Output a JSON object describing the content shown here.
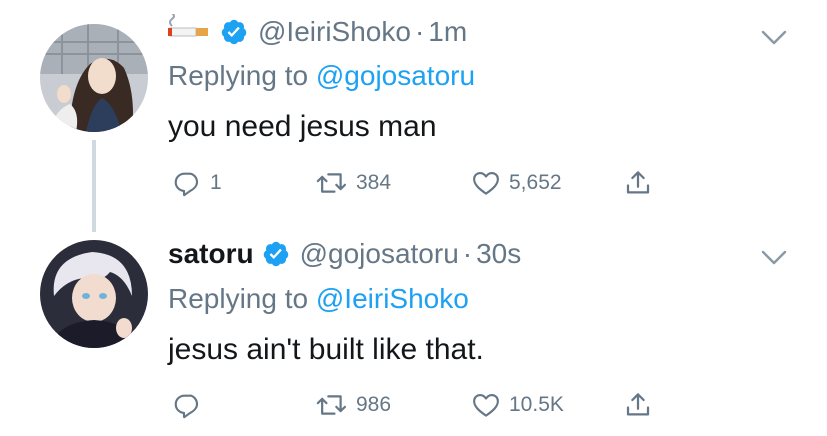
{
  "tweets": [
    {
      "display_name": "",
      "name_emoji": "cigarette-emoji",
      "handle": "@IeiriShoko",
      "separator": "·",
      "time": "1m",
      "replying_prefix": "Replying to",
      "replying_to": "@gojosatoru",
      "text": "you need jesus man",
      "reply_count": "1",
      "retweet_count": "384",
      "like_count": "5,652"
    },
    {
      "display_name": "satoru",
      "handle": "@gojosatoru",
      "separator": "·",
      "time": "30s",
      "replying_prefix": "Replying to",
      "replying_to": "@IeiriShoko",
      "text": "jesus ain't built like that.",
      "reply_count": "",
      "retweet_count": "986",
      "like_count": "10.5K"
    }
  ],
  "icons": {
    "verified": "verified-badge-icon",
    "reply": "reply-icon",
    "retweet": "retweet-icon",
    "like": "heart-icon",
    "share": "share-icon",
    "menu": "chevron-down-icon"
  },
  "colors": {
    "link": "#1da1f2",
    "muted": "#657786",
    "text": "#14171a",
    "thread_line": "#cfd9de"
  }
}
